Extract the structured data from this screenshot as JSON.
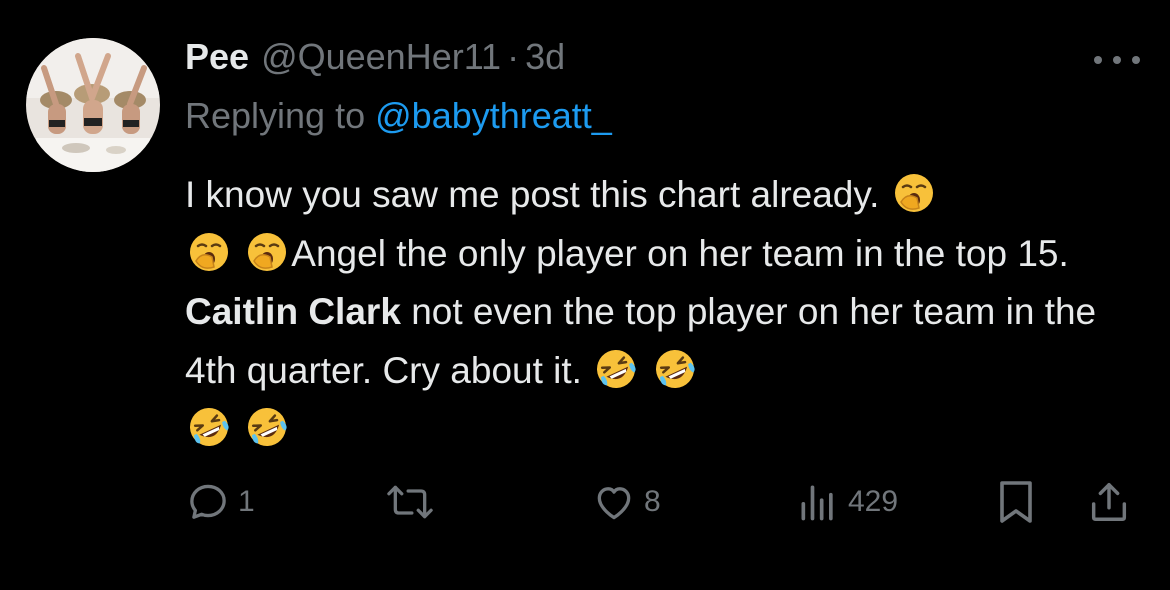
{
  "colors": {
    "background": "#000000",
    "text_primary": "#e7e9ea",
    "text_secondary": "#71767b",
    "accent": "#1d9bf0"
  },
  "tweet": {
    "display_name": "Pee",
    "handle": "@QueenHer11",
    "separator": "·",
    "time": "3d",
    "replying_prefix": "Replying to",
    "replying_to": "@babythreatt_",
    "text_part1": "I know you saw me post this chart already.",
    "text_part2": "Angel the only player on her team in the top 15.",
    "text_bold": "Caitlin Clark",
    "text_part3": "not even the top player on her team in the 4th quarter. Cry about it.",
    "emoji_1": "yawning-face",
    "emoji_2": "rolling-on-floor-laughing"
  },
  "actions": {
    "reply_count": "1",
    "like_count": "8",
    "views_count": "429"
  }
}
